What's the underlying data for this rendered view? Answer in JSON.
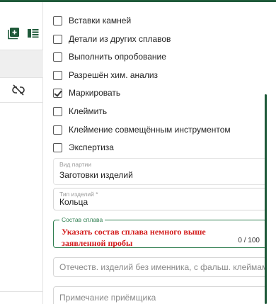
{
  "checkboxes": [
    {
      "label": "Вставки камней",
      "checked": false
    },
    {
      "label": "Детали из других сплавов",
      "checked": false
    },
    {
      "label": "Выполнить опробование",
      "checked": false
    },
    {
      "label": "Разрешён хим. анализ",
      "checked": false
    },
    {
      "label": "Маркировать",
      "checked": true
    },
    {
      "label": "Клеймить",
      "checked": false
    },
    {
      "label": "Клеймение совмещённым инструментом",
      "checked": false
    },
    {
      "label": "Экспертиза",
      "checked": false
    }
  ],
  "fields": {
    "batch_type": {
      "label": "Вид партии",
      "value": "Заготовки изделий"
    },
    "product_type": {
      "label": "Тип изделий *",
      "value": "Кольца"
    },
    "alloy_composition": {
      "label": "Состав сплава",
      "value": "Указать состав сплава немного выше заявленной пробы",
      "counter": "0 / 100"
    },
    "domestic_products": {
      "placeholder": "Отечеств. изделий без именника, с фальш. клеймами/..."
    },
    "receiver_note": {
      "placeholder": "Примечание приёмщика"
    }
  },
  "left_panel": {
    "icons": [
      "add-box-icon",
      "list-view-icon",
      "unlink-icon"
    ]
  },
  "colors": {
    "accent": "#2e7d4f",
    "brand_dark": "#1f5a3a",
    "annotation_red": "#d21a1a"
  }
}
